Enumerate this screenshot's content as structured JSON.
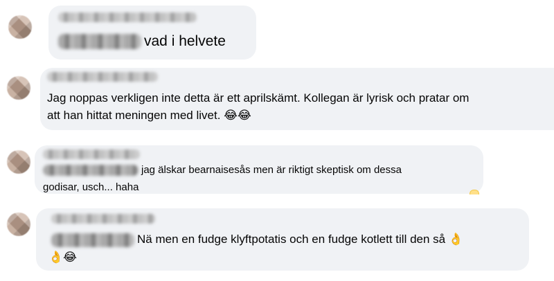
{
  "comments": [
    {
      "text": "vad i helvete"
    },
    {
      "line1": "Jag noppas verkligen inte detta är ett aprilskämt. Kollegan är lyrisk och pratar om",
      "line2": "att han hittat meningen med livet.",
      "emojis": [
        "😂",
        "😂"
      ]
    },
    {
      "line1": "jag älskar bearnaisesås men är riktigt skeptisk om dessa",
      "line2": "godisar, usch... haha"
    },
    {
      "line1": "Nä men en fudge klyftpotatis och en fudge kotlett till den så",
      "line1_emoji": "👌",
      "line2_emojis": [
        "👌",
        "😂"
      ]
    }
  ],
  "colors": {
    "bubble": "#f0f2f5",
    "text": "#050505",
    "background": "#ffffff"
  },
  "icons": [
    "avatar-blurred",
    "name-redacted",
    "mention-redacted",
    "reaction-icon"
  ]
}
